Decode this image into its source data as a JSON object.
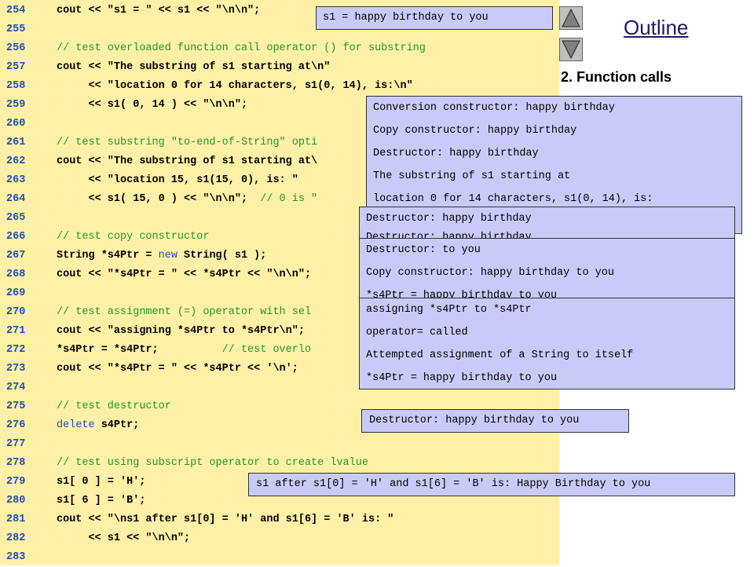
{
  "code": {
    "lines": [
      {
        "num": "254",
        "parts": [
          {
            "t": "cout << \"s1 = \" << s1 << \"\\n\\n\";",
            "c": "n"
          }
        ]
      },
      {
        "num": "255",
        "parts": []
      },
      {
        "num": "256",
        "parts": [
          {
            "t": "// test overloaded function call operator () for substring",
            "c": "cm"
          }
        ]
      },
      {
        "num": "257",
        "parts": [
          {
            "t": "cout << \"The substring of s1 starting at\\n\"",
            "c": "n"
          }
        ]
      },
      {
        "num": "258",
        "parts": [
          {
            "t": "     << \"location 0 for 14 characters, s1(0, 14), is:\\n\"",
            "c": "n"
          }
        ]
      },
      {
        "num": "259",
        "parts": [
          {
            "t": "     << s1( 0, 14 ) << \"\\n\\n\";",
            "c": "n"
          }
        ]
      },
      {
        "num": "260",
        "parts": []
      },
      {
        "num": "261",
        "parts": [
          {
            "t": "// test substring \"to-end-of-String\" opti",
            "c": "cm"
          }
        ]
      },
      {
        "num": "262",
        "parts": [
          {
            "t": "cout << \"The substring of s1 starting at\\",
            "c": "n"
          }
        ]
      },
      {
        "num": "263",
        "parts": [
          {
            "t": "     << \"location 15, s1(15, 0), is: \"",
            "c": "n"
          }
        ]
      },
      {
        "num": "264",
        "parts": [
          {
            "t": "     << s1( 15, 0 ) << \"\\n\\n\";  ",
            "c": "n"
          },
          {
            "t": "// 0 is \"",
            "c": "cm"
          }
        ]
      },
      {
        "num": "265",
        "parts": []
      },
      {
        "num": "266",
        "parts": [
          {
            "t": "// test copy constructor",
            "c": "cm"
          }
        ]
      },
      {
        "num": "267",
        "parts": [
          {
            "t": "String *s4Ptr = ",
            "c": "n"
          },
          {
            "t": "new",
            "c": "kw"
          },
          {
            "t": " String( s1 );",
            "c": "n"
          }
        ]
      },
      {
        "num": "268",
        "parts": [
          {
            "t": "cout << \"*s4Ptr = \" << *s4Ptr << \"\\n\\n\";",
            "c": "n"
          }
        ]
      },
      {
        "num": "269",
        "parts": []
      },
      {
        "num": "270",
        "parts": [
          {
            "t": "// test assignment (=) operator with sel",
            "c": "cm"
          }
        ]
      },
      {
        "num": "271",
        "parts": [
          {
            "t": "cout << \"assigning *s4Ptr to *s4Ptr\\n\";",
            "c": "n"
          }
        ]
      },
      {
        "num": "272",
        "parts": [
          {
            "t": "*s4Ptr = *s4Ptr;          ",
            "c": "n"
          },
          {
            "t": "// test overlo",
            "c": "cm"
          }
        ]
      },
      {
        "num": "273",
        "parts": [
          {
            "t": "cout << \"*s4Ptr = \" << *s4Ptr << '\\n';",
            "c": "n"
          }
        ]
      },
      {
        "num": "274",
        "parts": []
      },
      {
        "num": "275",
        "parts": [
          {
            "t": "// test destructor",
            "c": "cm"
          }
        ]
      },
      {
        "num": "276",
        "parts": [
          {
            "t": "delete",
            "c": "kw"
          },
          {
            "t": " s4Ptr;",
            "c": "n"
          }
        ]
      },
      {
        "num": "277",
        "parts": []
      },
      {
        "num": "278",
        "parts": [
          {
            "t": "// test using subscript operator to create lvalue",
            "c": "cm"
          }
        ]
      },
      {
        "num": "279",
        "parts": [
          {
            "t": "s1[ 0 ] = 'H';",
            "c": "n"
          }
        ]
      },
      {
        "num": "280",
        "parts": [
          {
            "t": "s1[ 6 ] = 'B';",
            "c": "n"
          }
        ]
      },
      {
        "num": "281",
        "parts": [
          {
            "t": "cout << \"\\ns1 after s1[0] = 'H' and s1[6] = 'B' is: \"",
            "c": "n"
          }
        ]
      },
      {
        "num": "282",
        "parts": [
          {
            "t": "     << s1 << \"\\n\\n\";",
            "c": "n"
          }
        ]
      },
      {
        "num": "283",
        "parts": []
      }
    ]
  },
  "sidebar": {
    "outline_title": "Outline",
    "section_label": "2. Function calls",
    "up_icon": "up-triangle-icon",
    "down_icon": "down-triangle-icon"
  },
  "outputs": {
    "box1": "s1 = happy birthday to you",
    "box2": [
      "Conversion constructor: happy birthday",
      "Copy constructor: happy birthday",
      "Destructor: happy birthday",
      "The substring of s1 starting at",
      "location 0 for 14 characters, s1(0, 14), is:"
    ],
    "box3": [
      "Destructor: happy birthday",
      "Destructor: happy birthday"
    ],
    "box4": [
      "Destructor: to you",
      "Copy constructor: happy birthday to you",
      "*s4Ptr = happy birthday to you"
    ],
    "box5": [
      "assigning *s4Ptr to *s4Ptr",
      "operator= called",
      "Attempted assignment of a String to itself",
      "*s4Ptr = happy birthday to you"
    ],
    "box6": "Destructor: happy birthday to you",
    "box7": "s1 after s1[0] = 'H' and s1[6] = 'B' is: Happy Birthday to you"
  },
  "colors": {
    "code_bg": "#fef1a7",
    "line_number": "#1f4fb3",
    "keyword": "#1f4fb3",
    "comment": "#1f9a1f",
    "output_bg": "#c8cbf7",
    "title": "#1a1a66"
  }
}
